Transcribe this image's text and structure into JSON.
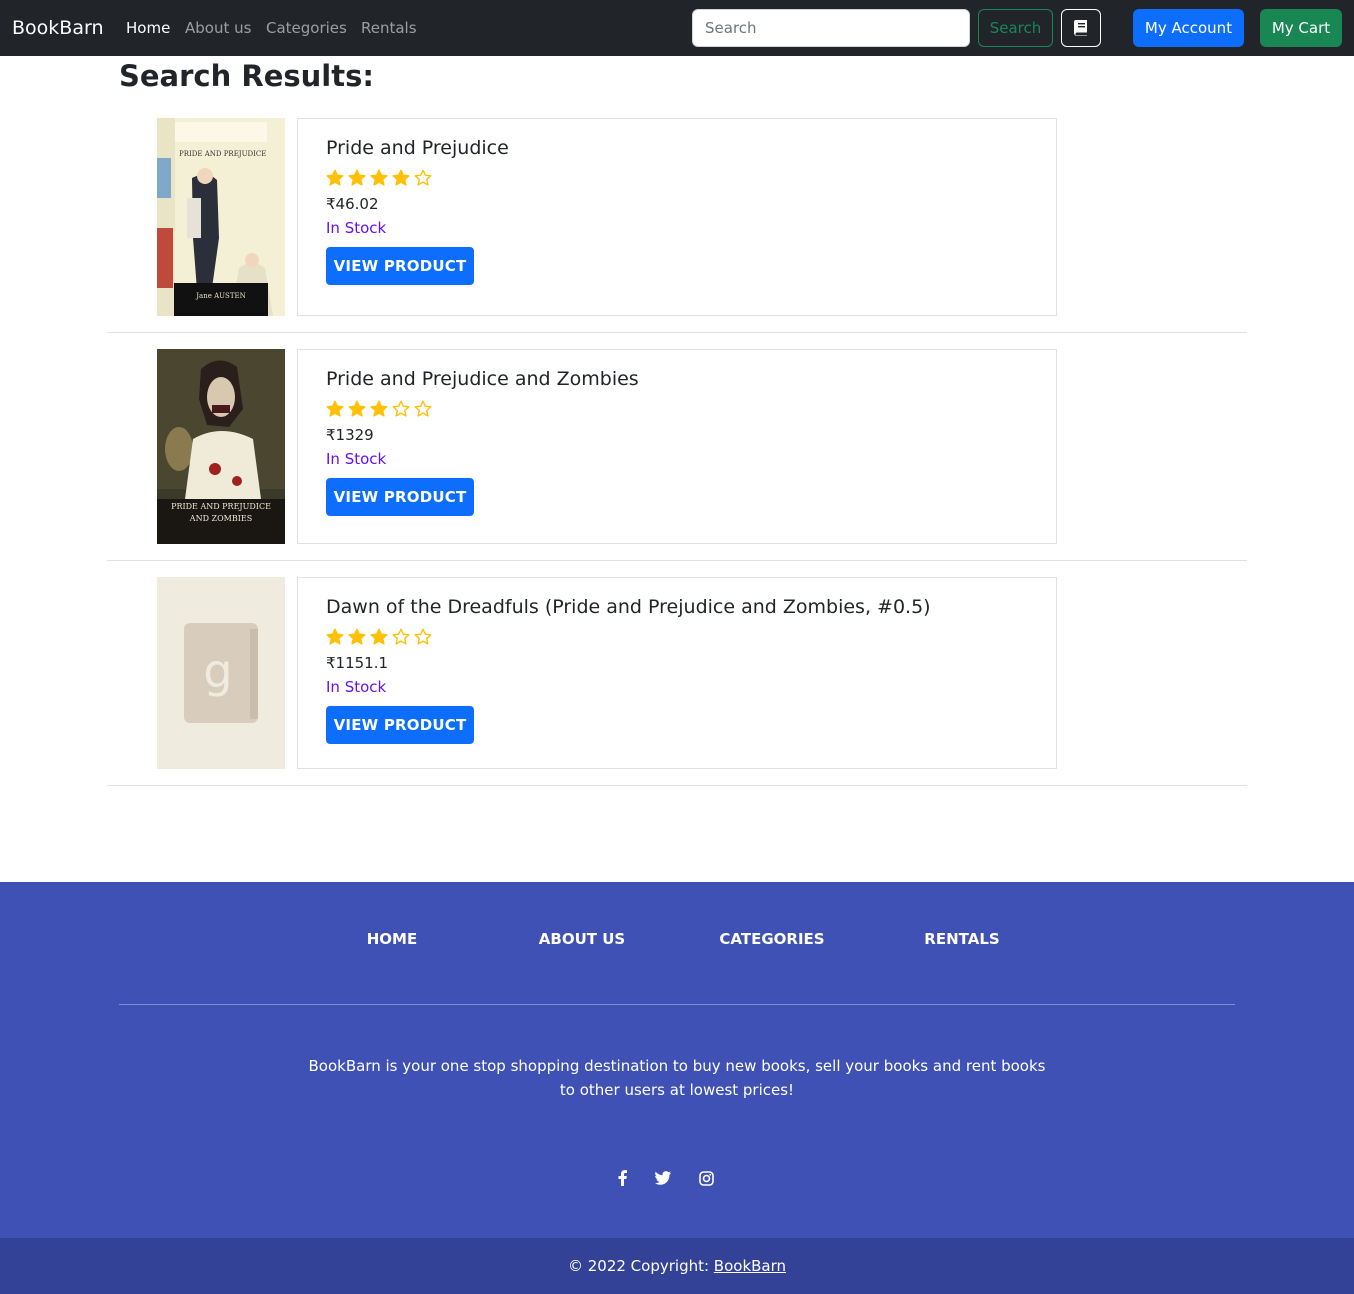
{
  "navbar": {
    "brand": "BookBarn",
    "links": [
      {
        "label": "Home",
        "active": true
      },
      {
        "label": "About us",
        "active": false
      },
      {
        "label": "Categories",
        "active": false
      },
      {
        "label": "Rentals",
        "active": false
      }
    ],
    "search": {
      "placeholder": "Search",
      "value": "",
      "button_label": "Search"
    },
    "book_button_icon": "book-icon",
    "account_label": "My Account",
    "cart_label": "My Cart"
  },
  "main": {
    "title": "Search Results:",
    "results": [
      {
        "title": "Pride and Prejudice",
        "rating": 4,
        "max_rating": 5,
        "price": "₹46.02",
        "stock": "In Stock",
        "button_label": "VIEW PRODUCT",
        "cover": {
          "title": "PRIDE AND PREJUDICE",
          "author": "Jane AUSTEN"
        }
      },
      {
        "title": "Pride and Prejudice and Zombies",
        "rating": 3,
        "max_rating": 5,
        "price": "₹1329",
        "stock": "In Stock",
        "button_label": "VIEW PRODUCT",
        "cover": {
          "title_line1": "PRIDE AND PREJUDICE",
          "title_line2": "AND ZOMBIES"
        }
      },
      {
        "title": "Dawn of the Dreadfuls (Pride and Prejudice and Zombies, #0.5)",
        "rating": 3,
        "max_rating": 5,
        "price": "₹1151.1",
        "stock": "In Stock",
        "button_label": "VIEW PRODUCT",
        "cover": {
          "placeholder_letter": "g"
        }
      }
    ]
  },
  "footer": {
    "links": [
      "HOME",
      "ABOUT US",
      "CATEGORIES",
      "RENTALS"
    ],
    "description": "BookBarn is your one stop shopping destination to buy new books, sell your books and rent books to other users at lowest prices!",
    "social": [
      "facebook-icon",
      "twitter-icon",
      "instagram-icon"
    ],
    "copyright_prefix": "© 2022 Copyright: ",
    "copyright_link": "BookBarn"
  },
  "colors": {
    "navbar_bg": "#212529",
    "primary": "#0d6efd",
    "success": "#198754",
    "stock": "#6610f2",
    "star": "#ffc107",
    "footer_bg": "#3f51b5",
    "copyright_bg": "#334296"
  }
}
